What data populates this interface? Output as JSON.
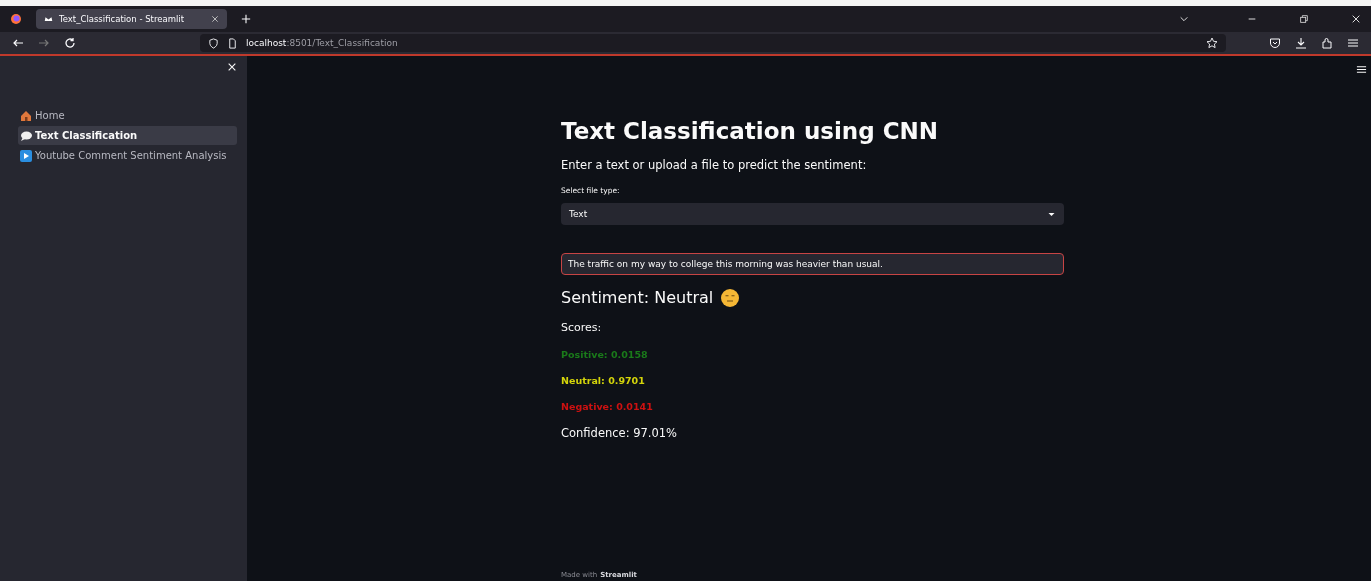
{
  "browser": {
    "tab_title": "Text_Classification - Streamlit",
    "url_host": "localhost",
    "url_path": ":8501/Text_Classification"
  },
  "sidebar": {
    "items": [
      {
        "label": "Home",
        "kind": "house",
        "selected": false
      },
      {
        "label": "Text Classification",
        "kind": "bubble",
        "selected": true
      },
      {
        "label": "Youtube Comment Sentiment Analysis",
        "kind": "play",
        "selected": false
      }
    ]
  },
  "main": {
    "title": "Text Classification using CNN",
    "subtitle": "Enter a text or upload a file to predict the sentiment:",
    "select": {
      "label": "Select file type:",
      "value": "Text"
    },
    "text_input": {
      "value": "The traffic on my way to college this morning was heavier than usual."
    },
    "sentiment": "Sentiment: Neutral",
    "scores_label": "Scores:",
    "scores": [
      {
        "text": "Positive: 0.0158",
        "color": "#1a7a1a"
      },
      {
        "text": "Neutral: 0.9701",
        "color": "#d4d40a"
      },
      {
        "text": "Negative: 0.0141",
        "color": "#cc1111"
      }
    ],
    "confidence": "Confidence: 97.01%",
    "footer": {
      "prefix": "Made with",
      "brand": "Streamlit"
    }
  }
}
